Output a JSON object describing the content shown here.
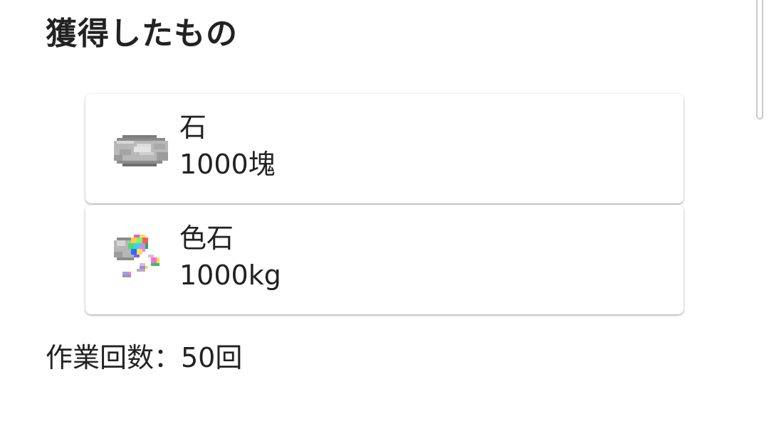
{
  "page": {
    "title": "獲得したもの"
  },
  "items": [
    {
      "name": "石",
      "amount": "1000塊",
      "icon": "stone-icon"
    },
    {
      "name": "色石",
      "amount": "1000kg",
      "icon": "colored-stone-icon"
    }
  ],
  "footer": {
    "work_count": "作業回数：50回"
  }
}
